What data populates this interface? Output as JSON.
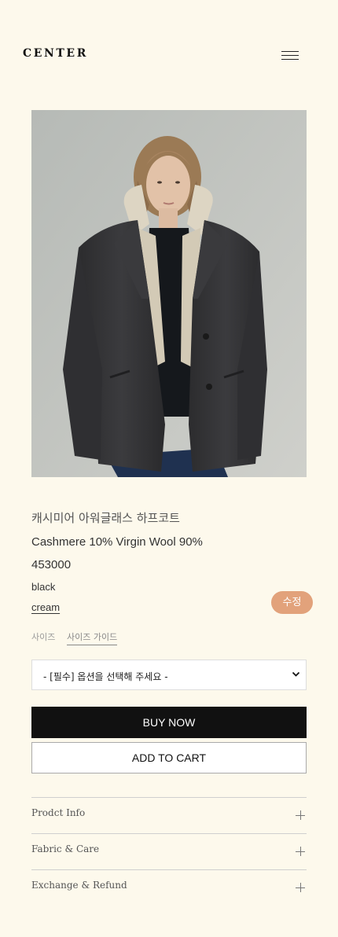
{
  "header": {
    "logo": "CENTER",
    "menu_icon": "hamburger-menu-icon"
  },
  "product": {
    "image_alt": "model-wearing-charcoal-wool-coat",
    "name_ko": "캐시미어 아워글래스 하프코트",
    "name_en": "Cashmere 10% Virgin Wool 90%",
    "price": "453000",
    "colors": [
      "black",
      "cream"
    ],
    "selected_color": "cream"
  },
  "edit_button": {
    "label": "수정",
    "color": "#e2a27b"
  },
  "size": {
    "label": "사이즈",
    "guide_link": "사이즈 가이드"
  },
  "option_select": {
    "selected": "- [필수] 옵션을 선택해 주세요 -"
  },
  "actions": {
    "buy_now": "BUY NOW",
    "add_to_cart": "ADD TO CART"
  },
  "accordions": [
    {
      "label": "Prodct Info",
      "icon": "plus-icon"
    },
    {
      "label": "Fabric & Care",
      "icon": "plus-icon"
    },
    {
      "label": "Exchange & Refund",
      "icon": "plus-icon"
    }
  ],
  "colors": {
    "background": "#fdf9ec",
    "accent": "#e2a27b",
    "buy_button": "#111111"
  }
}
